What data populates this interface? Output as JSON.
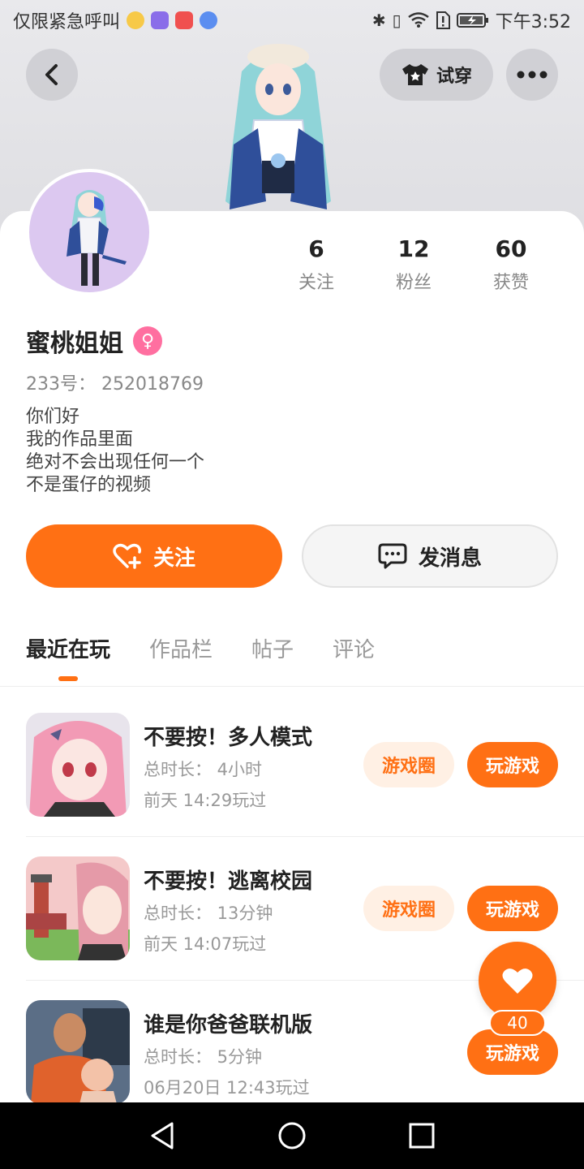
{
  "status_bar": {
    "carrier_text": "仅限紧急呼叫",
    "time": "下午3:52",
    "app_icons": [
      "qq-browser-icon",
      "app-purple-icon",
      "huawei-appgallery-icon",
      "music-icon"
    ],
    "system_icons": [
      "bluetooth-icon",
      "vibrate-icon",
      "wifi-icon",
      "sim-alert-icon",
      "battery-charging-icon"
    ]
  },
  "header": {
    "tryon_label": "试穿",
    "colors": {
      "banner_bg": "#e5e5e8",
      "avatar_bg": "#dcc8f0"
    }
  },
  "profile": {
    "stats": [
      {
        "value": "6",
        "label": "关注"
      },
      {
        "value": "12",
        "label": "粉丝"
      },
      {
        "value": "60",
        "label": "获赞"
      }
    ],
    "name": "蜜桃姐姐",
    "gender_glyph": "♀",
    "uid": "233号：  252018769",
    "bio_lines": [
      "你们好",
      "我的作品里面",
      "绝对不会出现任何一个",
      "不是蛋仔的视频"
    ]
  },
  "actions": {
    "follow_label": "关注",
    "message_label": "发消息"
  },
  "tabs": [
    {
      "label": "最近在玩",
      "active": true
    },
    {
      "label": "作品栏",
      "active": false
    },
    {
      "label": "帖子",
      "active": false
    },
    {
      "label": "评论",
      "active": false
    }
  ],
  "games": [
    {
      "title": "不要按！多人模式",
      "duration": "总时长：  4小时",
      "last_played": "前天 14:29玩过",
      "circle_label": "游戏圈",
      "play_label": "玩游戏"
    },
    {
      "title": "不要按！逃离校园",
      "duration": "总时长：  13分钟",
      "last_played": "前天 14:07玩过",
      "circle_label": "游戏圈",
      "play_label": "玩游戏"
    },
    {
      "title": "谁是你爸爸联机版",
      "duration": "总时长：  5分钟",
      "last_played": "06月20日 12:43玩过",
      "play_label": "玩游戏"
    }
  ],
  "floating_like": {
    "count": "40"
  },
  "colors": {
    "accent": "#ff7014",
    "accent_light": "#fff0e4",
    "text_secondary": "#999999"
  }
}
